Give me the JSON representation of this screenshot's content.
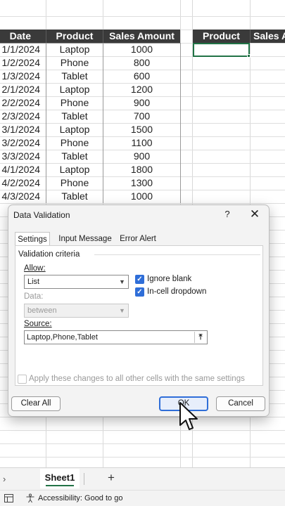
{
  "sheet": {
    "headers": [
      "Date",
      "Product",
      "Sales Amount"
    ],
    "rows": [
      [
        "1/1/2024",
        "Laptop",
        "1000"
      ],
      [
        "1/2/2024",
        "Phone",
        "800"
      ],
      [
        "1/3/2024",
        "Tablet",
        "600"
      ],
      [
        "2/1/2024",
        "Laptop",
        "1200"
      ],
      [
        "2/2/2024",
        "Phone",
        "900"
      ],
      [
        "2/3/2024",
        "Tablet",
        "700"
      ],
      [
        "3/1/2024",
        "Laptop",
        "1500"
      ],
      [
        "3/2/2024",
        "Phone",
        "1100"
      ],
      [
        "3/3/2024",
        "Tablet",
        "900"
      ],
      [
        "4/1/2024",
        "Laptop",
        "1800"
      ],
      [
        "4/2/2024",
        "Phone",
        "1300"
      ],
      [
        "4/3/2024",
        "Tablet",
        "1000"
      ]
    ],
    "side_headers": [
      "Product",
      "Sales A"
    ],
    "accent_color": "#217346",
    "header_bg": "#3a3a3a"
  },
  "dialog": {
    "title": "Data Validation",
    "help_glyph": "?",
    "close_glyph": "✕",
    "tabs": [
      "Settings",
      "Input Message",
      "Error Alert"
    ],
    "active_tab": "Settings",
    "criteria_label": "Validation criteria",
    "allow_label": "Allow:",
    "allow_value": "List",
    "ignore_blank_label": "Ignore blank",
    "ignore_blank_checked": true,
    "incell_dropdown_label": "In-cell dropdown",
    "incell_dropdown_checked": true,
    "data_label": "Data:",
    "data_value": "between",
    "source_label": "Source:",
    "source_value": "Laptop,Phone,Tablet",
    "apply_all_label": "Apply these changes to all other cells with the same settings",
    "apply_all_checked": false,
    "clear_all_label": "Clear All",
    "ok_label": "OK",
    "cancel_label": "Cancel",
    "checkbox_color": "#2f6ed8"
  },
  "sheetbar": {
    "nav_glyph": "›",
    "active_sheet": "Sheet1",
    "add_glyph": "+"
  },
  "statusbar": {
    "cell_mode_icon": "cell-mode-icon",
    "accessibility_icon": "accessibility-icon",
    "accessibility_text": "Accessibility: Good to go"
  }
}
